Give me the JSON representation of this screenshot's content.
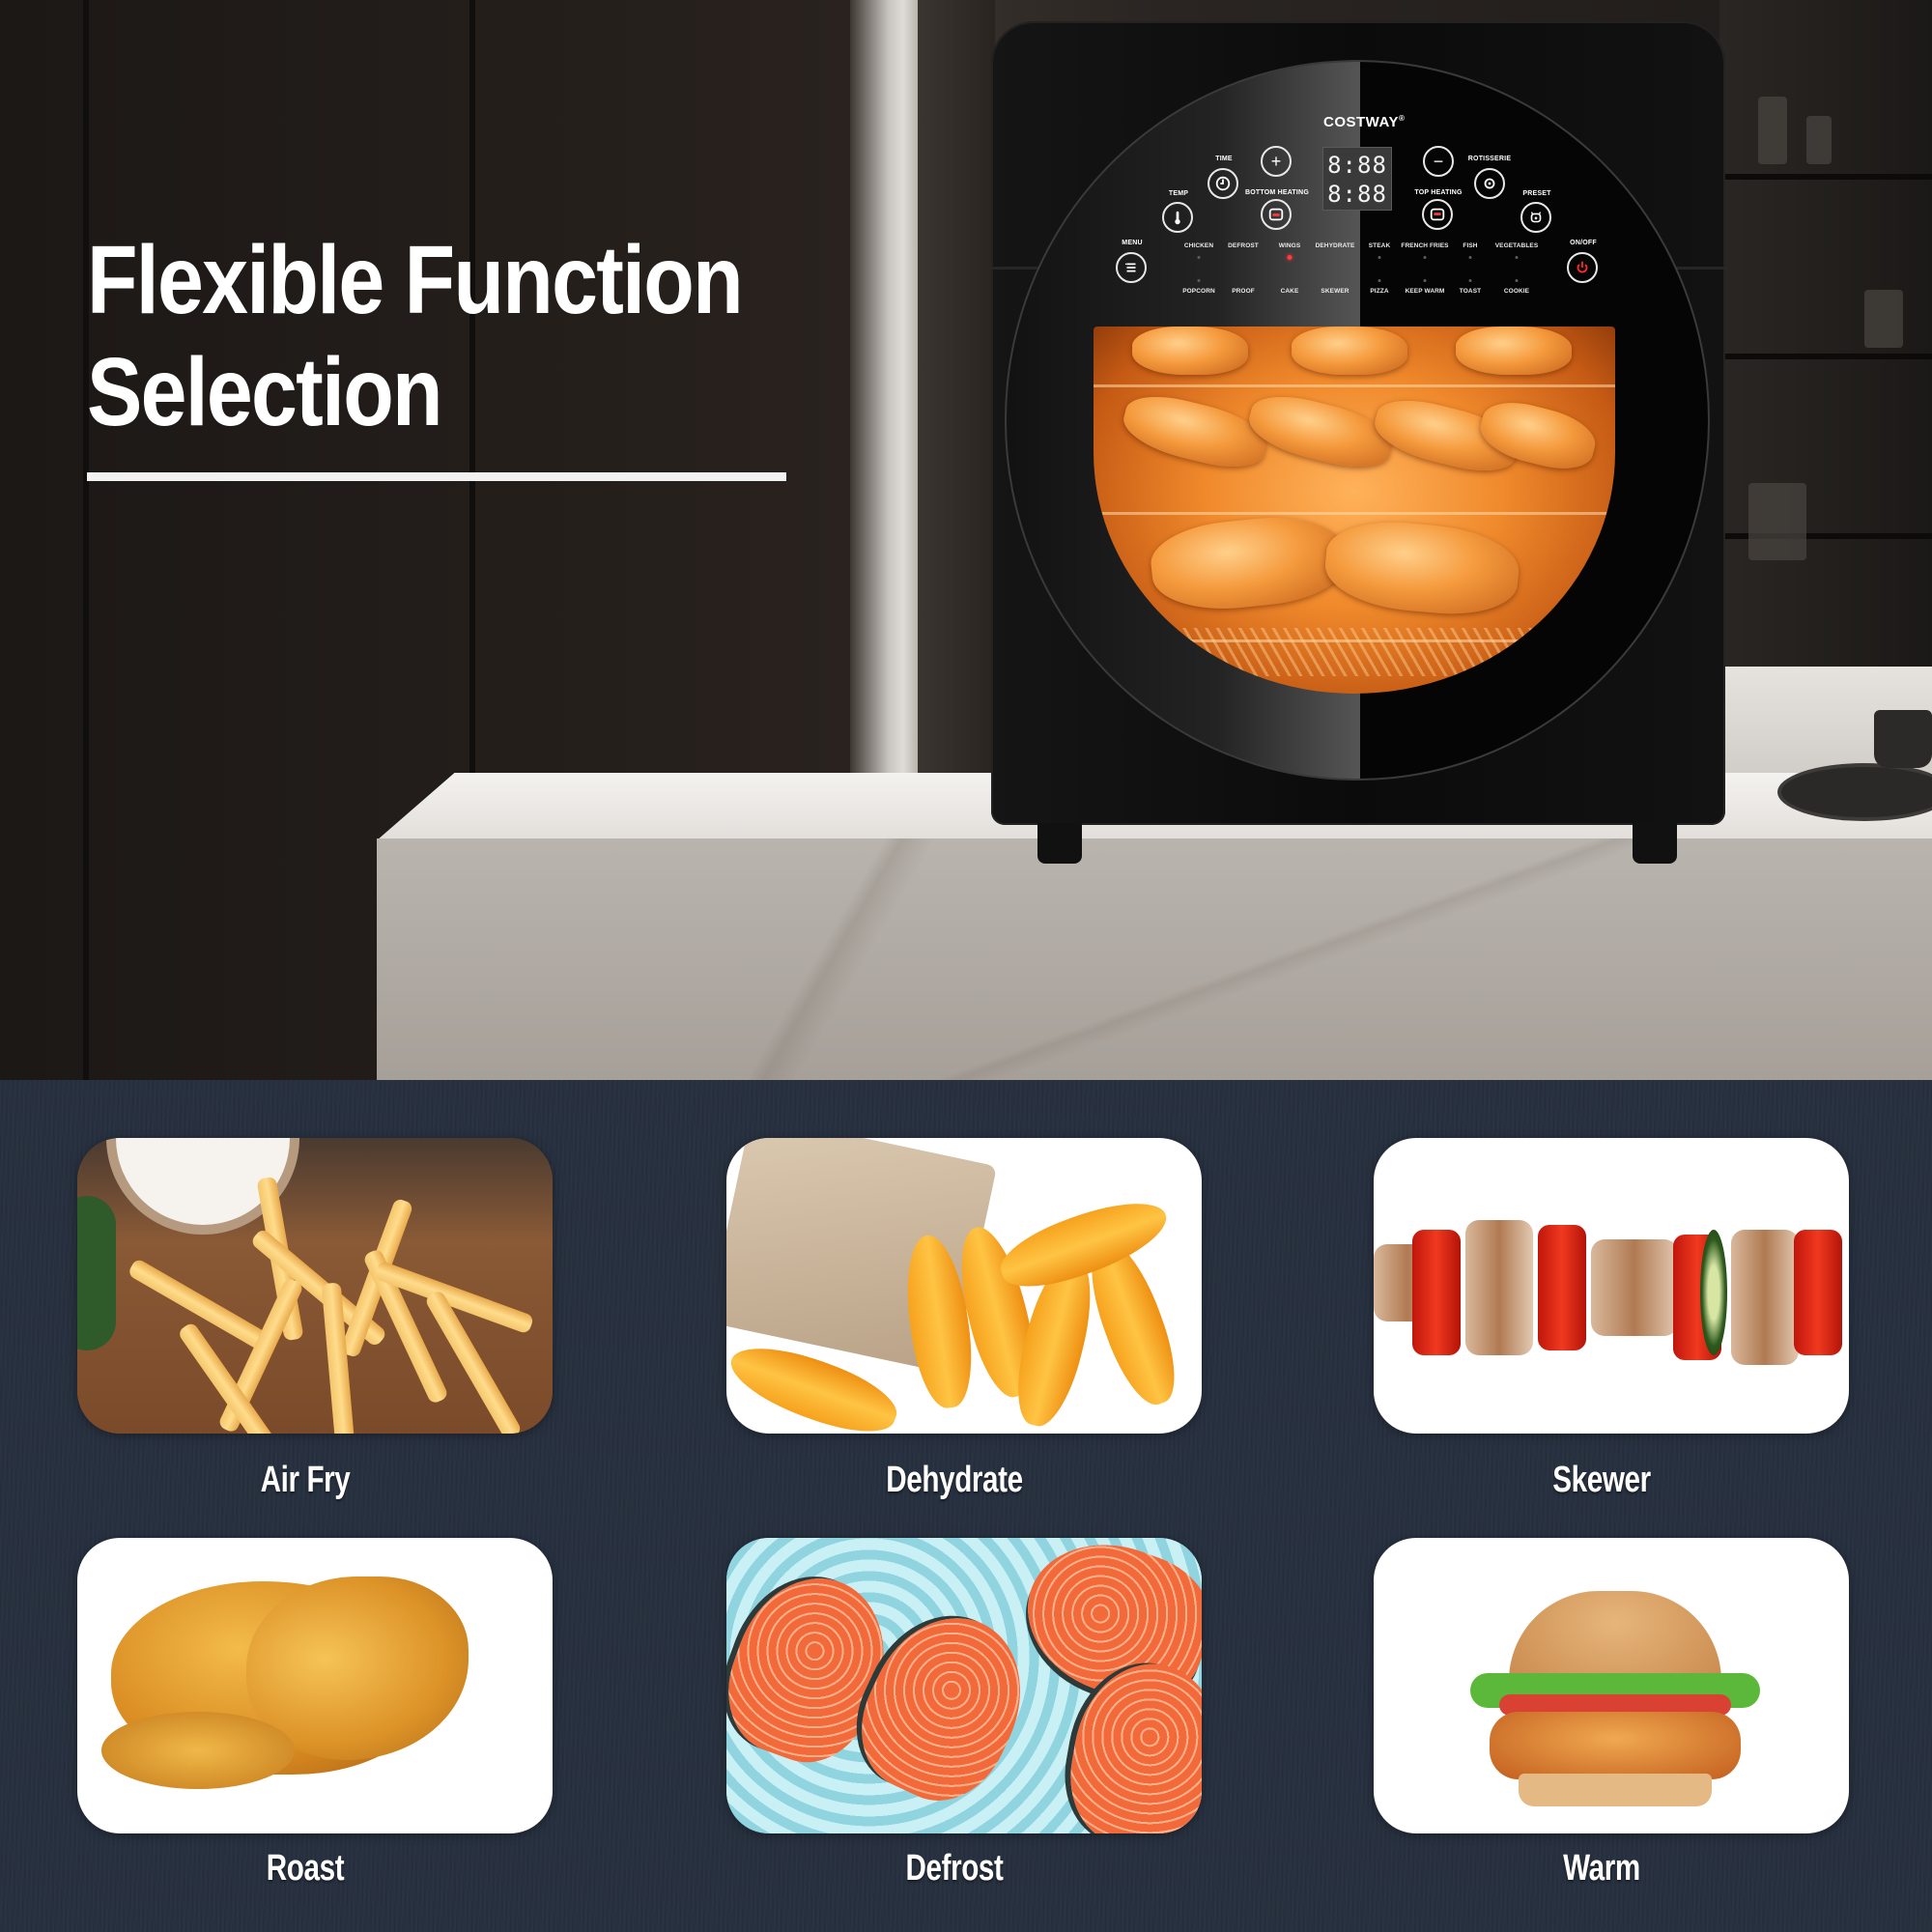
{
  "headline": {
    "line1": "Flexible Function",
    "line2": "Selection"
  },
  "appliance": {
    "brand": "COSTWAY",
    "brand_mark": "®",
    "display": {
      "row1": "8:88",
      "row2": "8:88"
    },
    "buttons": {
      "menu": "MENU",
      "temp": "TEMP",
      "time": "TIME",
      "plus": "+",
      "bottom_heating": "BOTTOM HEATING",
      "minus": "−",
      "top_heating": "TOP HEATING",
      "rotisserie": "ROTISSERIE",
      "preset": "PRESET",
      "on_off": "ON/OFF"
    },
    "functions_row1": [
      "CHICKEN",
      "DEFROST",
      "WINGS",
      "DEHYDRATE",
      "STEAK",
      "FRENCH FRIES",
      "FISH",
      "VEGETABLES"
    ],
    "functions_row2": [
      "POPCORN",
      "PROOF",
      "CAKE",
      "SKEWER",
      "PIZZA",
      "KEEP WARM",
      "TOAST",
      "COOKIE"
    ],
    "active_function": "WINGS",
    "indicator_color": "#ff3a3a"
  },
  "features": [
    {
      "label": "Air Fry",
      "image": "french-fries"
    },
    {
      "label": "Dehydrate",
      "image": "dried-mango"
    },
    {
      "label": "Skewer",
      "image": "kebab-skewer"
    },
    {
      "label": "Roast",
      "image": "roast-chicken"
    },
    {
      "label": "Defrost",
      "image": "salmon-on-ice"
    },
    {
      "label": "Warm",
      "image": "chicken-burger"
    }
  ],
  "colors": {
    "grid_background": "#27303f",
    "text": "#ffffff",
    "oven_body": "#0b0b0b",
    "window_glow": "#f08a2c"
  }
}
